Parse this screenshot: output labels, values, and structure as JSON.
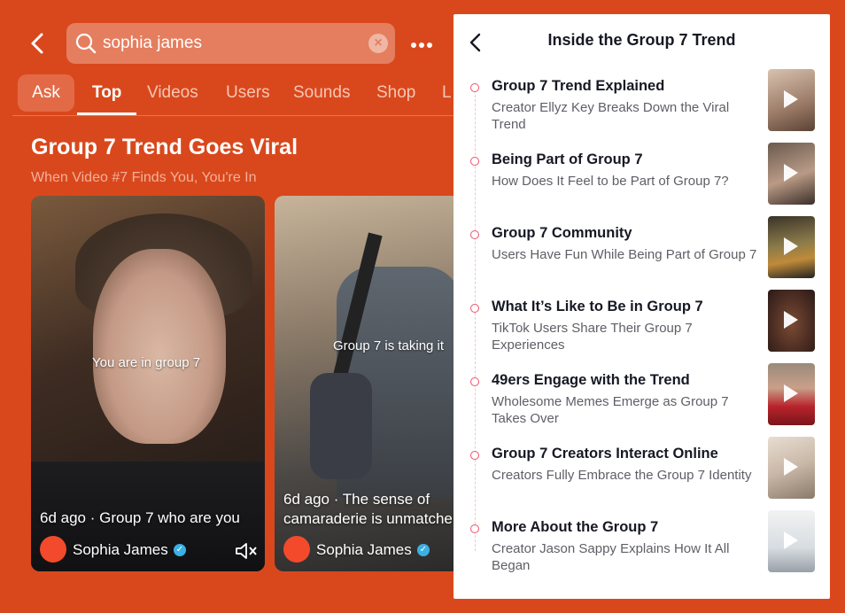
{
  "search": {
    "query": "sophia james"
  },
  "tabs": [
    {
      "label": "Ask"
    },
    {
      "label": "Top"
    },
    {
      "label": "Videos"
    },
    {
      "label": "Users"
    },
    {
      "label": "Sounds"
    },
    {
      "label": "Shop"
    },
    {
      "label": "L"
    }
  ],
  "collection": {
    "title": "Group 7 Trend Goes Viral",
    "subtitle": "When Video #7 Finds You, You're In"
  },
  "videos": [
    {
      "overlay": "You are in group 7",
      "caption": "6d ago · Group 7 who are you",
      "user": "Sophia James"
    },
    {
      "overlay": "Group 7 is taking it",
      "caption_line1": "6d ago · The sense of",
      "caption_line2": "camaraderie is unmatche",
      "user": "Sophia James"
    }
  ],
  "panel": {
    "title": "Inside the Group 7 Trend",
    "items": [
      {
        "title": "Group 7 Trend Explained",
        "desc": "Creator Ellyz Key Breaks Down the Viral Trend"
      },
      {
        "title": "Being Part of Group 7",
        "desc": "How Does It Feel to be Part of Group 7?"
      },
      {
        "title": "Group 7 Community",
        "desc": "Users Have Fun While Being Part of Group 7"
      },
      {
        "title": "What It’s Like to Be in Group 7",
        "desc": "TikTok Users Share Their Group 7 Experiences"
      },
      {
        "title": "49ers Engage with the Trend",
        "desc": "Wholesome Memes Emerge as Group 7 Takes Over"
      },
      {
        "title": "Group 7 Creators Interact Online",
        "desc": "Creators Fully Embrace the Group 7 Identity"
      },
      {
        "title": "More About the Group 7",
        "desc": "Creator Jason Sappy Explains How It All Began"
      }
    ]
  },
  "colors": {
    "accent": "#d9481c",
    "verified": "#3bb0e6",
    "avatar": "#f24a2b"
  }
}
